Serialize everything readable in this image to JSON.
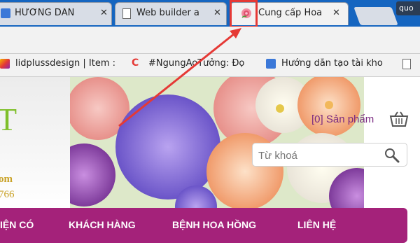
{
  "browser": {
    "tabs": [
      {
        "label": "HƯỚNG DẪN",
        "close": "✕"
      },
      {
        "label": "Web builder a",
        "close": "✕"
      },
      {
        "label": "Cung cấp Hoa",
        "close": "✕"
      },
      {
        "label": "quo"
      }
    ]
  },
  "bookmarks": [
    {
      "label": "lidplussdesign | Item :"
    },
    {
      "label": "#NgungAoTưởng: Đọ",
      "icon_text": "C"
    },
    {
      "label": "Hướng dẫn tạo tài kho"
    }
  ],
  "site": {
    "logo_fragment": "T",
    "logo_sub_1": "om",
    "logo_sub_2": "766",
    "cart_text": "[0] Sản phẩm",
    "search": {
      "placeholder": "Từ khoá"
    },
    "nav": [
      {
        "label": "IỆN CÓ"
      },
      {
        "label": "KHÁCH HÀNG"
      },
      {
        "label": "BỆNH HOA HỒNG"
      },
      {
        "label": "LIÊN HỆ"
      }
    ]
  },
  "colors": {
    "tabstrip": "#1565c0",
    "highlight": "#e53935",
    "nav": "#a4227a",
    "cart": "#7b2c82",
    "logo": "#7fbf2a",
    "gold": "#c9a227"
  },
  "icons": [
    "page-icon",
    "flower-favicon-icon",
    "close-icon",
    "cart-icon",
    "search-icon"
  ]
}
